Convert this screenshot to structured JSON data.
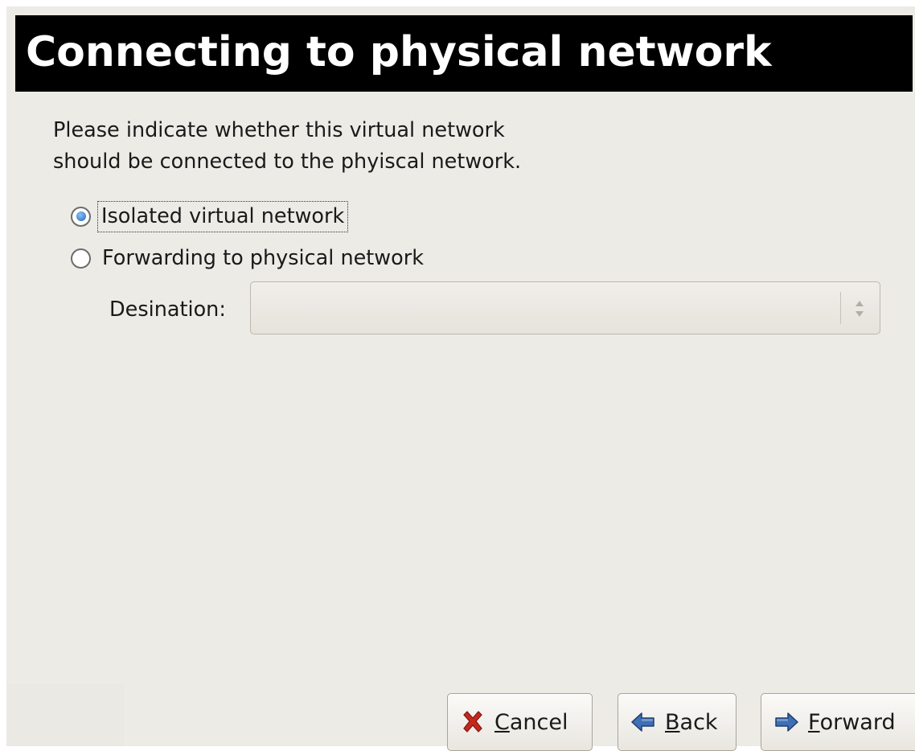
{
  "title": "Connecting to physical network",
  "intro": {
    "line1": "Please indicate whether this virtual network",
    "line2": "should be connected to the phyiscal network."
  },
  "options": {
    "isolated": {
      "label": "Isolated virtual network",
      "checked": true
    },
    "forwarding": {
      "label": "Forwarding to physical network",
      "checked": false
    }
  },
  "destination": {
    "label": "Desination:",
    "value": ""
  },
  "buttons": {
    "cancel": {
      "mnemonic": "C",
      "rest": "ancel",
      "icon": "cancel-x-icon"
    },
    "back": {
      "mnemonic": "B",
      "rest": "ack",
      "icon": "back-arrow-icon"
    },
    "forward": {
      "mnemonic": "F",
      "rest": "orward",
      "icon": "forward-arrow-icon"
    }
  },
  "colors": {
    "title_bg": "#000000",
    "title_fg": "#ffffff",
    "window_bg": "#edebe6",
    "radio_accent": "#3d82d2",
    "cancel_red": "#c4281c",
    "arrow_blue": "#3f6fb5"
  }
}
